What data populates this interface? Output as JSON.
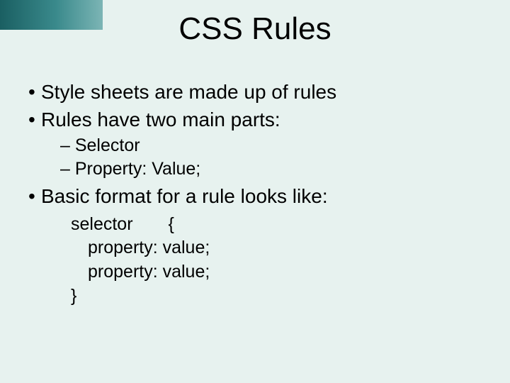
{
  "title": "CSS Rules",
  "bullets": {
    "b1": "Style sheets are made up of rules",
    "b2": "Rules have two main parts:",
    "b2_sub1": "– Selector",
    "b2_sub2": "– Property: Value;",
    "b3": "Basic format for a rule looks like:"
  },
  "code": {
    "line1": "selector  {",
    "line2": "property: value;",
    "line3": "property: value;",
    "line4": "}"
  }
}
